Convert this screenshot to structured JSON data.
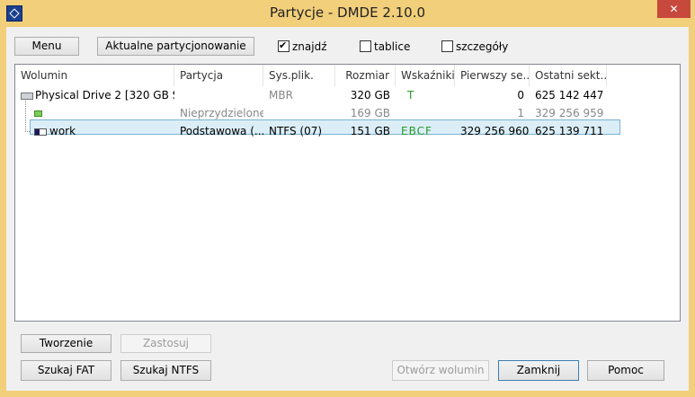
{
  "window": {
    "title": "Partycje - DMDE 2.10.0",
    "close_symbol": "✕"
  },
  "toolbar": {
    "menu_label": "Menu",
    "current_partitioning_label": "Aktualne partycjonowanie",
    "find": {
      "label": "znajdź",
      "checked": true
    },
    "tables": {
      "label": "tablice",
      "checked": false
    },
    "details": {
      "label": "szczegóły",
      "checked": false
    }
  },
  "columns": [
    "Wolumin",
    "Partycja",
    "Sys.plik.",
    "Rozmiar",
    "Wskaźniki",
    "Pierwszy se...",
    "Ostatni sekt..."
  ],
  "rows": [
    {
      "volume": "Physical Drive 2 [320 GB ST...",
      "partition": "",
      "fs": "MBR",
      "size": "320 GB",
      "flags": "T",
      "first": "0",
      "last": "625 142 447",
      "icon": "drive-icon"
    },
    {
      "volume": "",
      "partition": "Nieprzydzielone",
      "fs": "",
      "size": "169 GB",
      "flags": "",
      "first": "1",
      "last": "329 256 959",
      "icon": "unallocated-icon"
    },
    {
      "volume": "work",
      "partition": "Podstawowa (...",
      "fs": "NTFS (07)",
      "size": "151 GB",
      "flags": "EBCF",
      "first": "329 256 960",
      "last": "625 139 711",
      "icon": "volume-icon"
    }
  ],
  "bottom": {
    "create_label": "Tworzenie",
    "apply_label": "Zastosuj",
    "search_fat_label": "Szukaj FAT",
    "search_ntfs_label": "Szukaj NTFS",
    "open_volume_label": "Otwórz wolumin",
    "close_label": "Zamknij",
    "help_label": "Pomoc"
  },
  "colors": {
    "frame": "#f2cf7a",
    "close_button": "#c7483d",
    "selection": "#dbeef7",
    "flag_green": "#2a9a2a"
  }
}
